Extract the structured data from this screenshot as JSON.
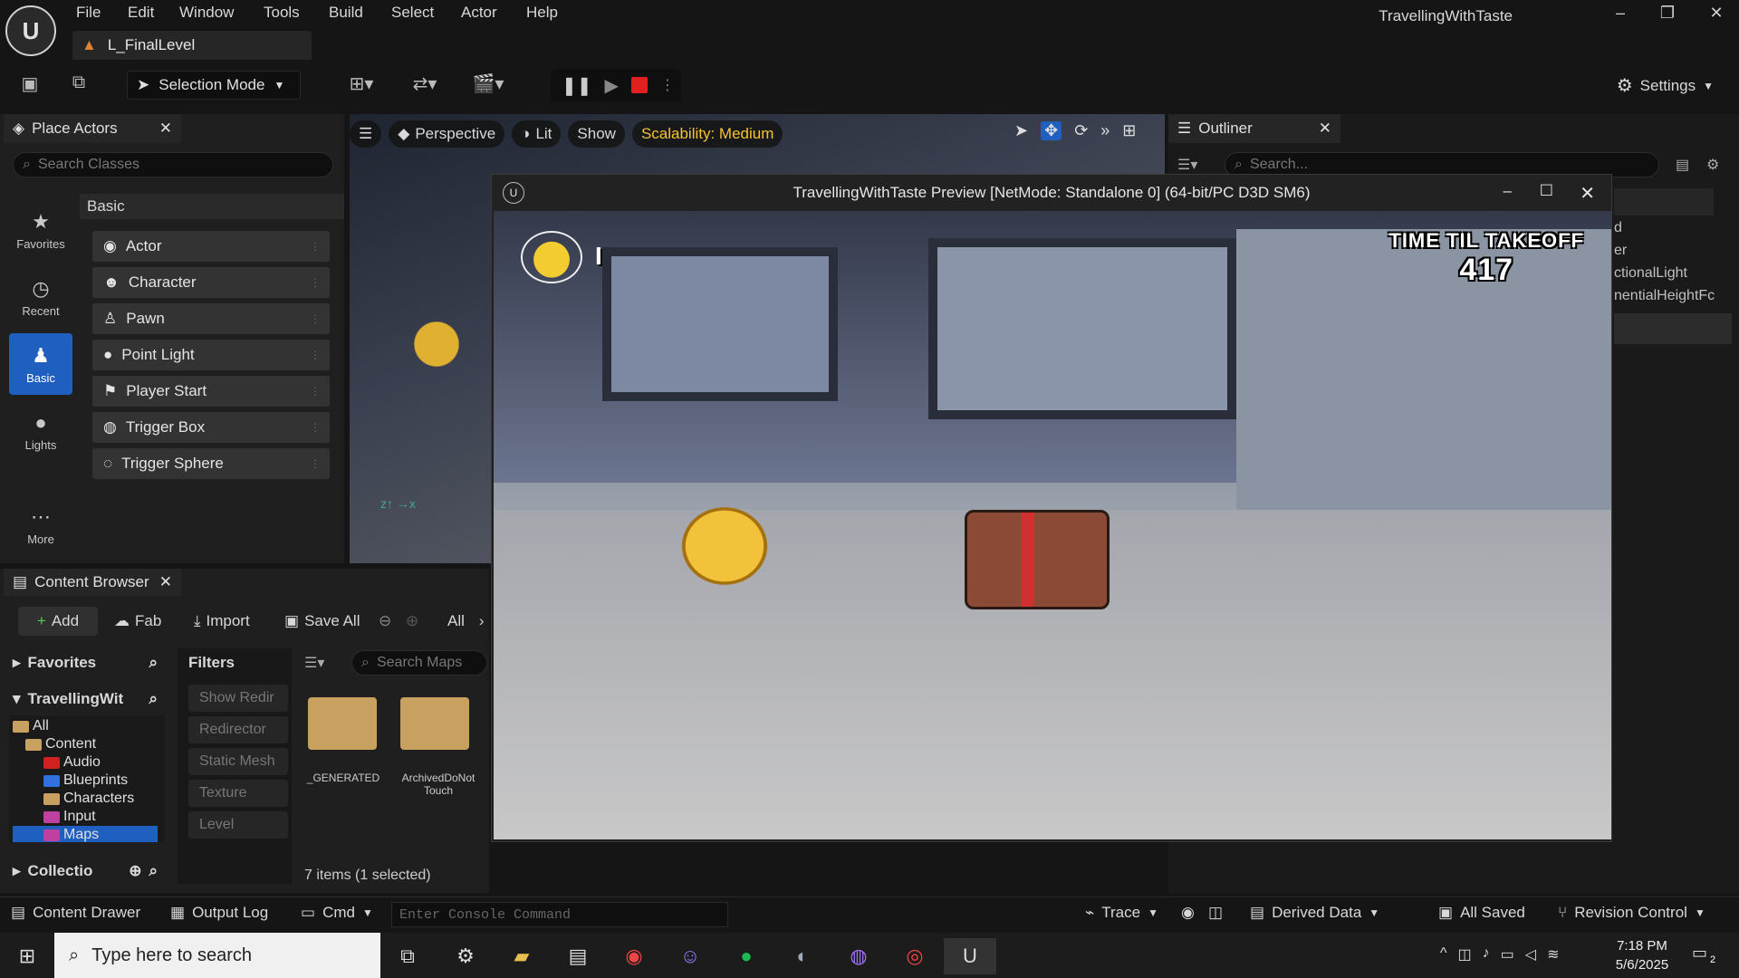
{
  "menu": [
    "File",
    "Edit",
    "Window",
    "Tools",
    "Build",
    "Select",
    "Actor",
    "Help"
  ],
  "project_name": "TravellingWithTaste",
  "level_tab": "L_FinalLevel",
  "toolbar": {
    "selection_mode": "Selection Mode",
    "settings": "Settings"
  },
  "place_actors": {
    "title": "Place Actors",
    "search_placeholder": "Search Classes",
    "categories": [
      {
        "label": "Favorites",
        "icon": "star-icon"
      },
      {
        "label": "Recent",
        "icon": "clock-icon"
      },
      {
        "label": "Basic",
        "icon": "basic-actors-icon"
      },
      {
        "label": "Lights",
        "icon": "bulb-icon"
      },
      {
        "label": "More",
        "icon": "ellipsis-icon"
      }
    ],
    "section": "Basic",
    "items": [
      "Actor",
      "Character",
      "Pawn",
      "Point Light",
      "Player Start",
      "Trigger Box",
      "Trigger Sphere"
    ]
  },
  "viewport": {
    "perspective": "Perspective",
    "lit": "Lit",
    "show": "Show",
    "scalability": "Scalability: Medium"
  },
  "outliner": {
    "title": "Outliner",
    "search_placeholder": "Search...",
    "rows": [
      "d",
      "er",
      "ctionalLight",
      "nentialHeightFc"
    ]
  },
  "preview": {
    "title": "TravellingWithTaste Preview [NetMode: Standalone 0]  (64-bit/PC D3D SM6)",
    "hud_label": "TIME TIL TAKEOFF",
    "hud_value": "417",
    "cheese_count": "I"
  },
  "content_browser": {
    "title": "Content Browser",
    "add": "Add",
    "fab": "Fab",
    "import": "Import",
    "save_all": "Save All",
    "path": "All",
    "favorites": "Favorites",
    "project": "TravellingWit",
    "collections": "Collectio",
    "filters_title": "Filters",
    "search_placeholder": "Search Maps",
    "tree": [
      "All",
      "Content",
      "Audio",
      "Blueprints",
      "Characters",
      "Input",
      "Maps"
    ],
    "filters": [
      "Show Redir",
      "Redirector",
      "Static Mesh",
      "Texture",
      "Level"
    ],
    "assets": [
      "_GENERATED",
      "ArchivedDoNot Touch"
    ],
    "status": "7 items (1 selected)"
  },
  "bottom_bar": {
    "content_drawer": "Content Drawer",
    "output_log": "Output Log",
    "cmd": "Cmd",
    "console_placeholder": "Enter Console Command",
    "trace": "Trace",
    "derived_data": "Derived Data",
    "all_saved": "All Saved",
    "revision_control": "Revision Control"
  },
  "taskbar": {
    "search_placeholder": "Type here to search",
    "time": "7:18 PM",
    "date": "5/6/2025",
    "notifications": "2"
  },
  "colors": {
    "accent": "#1f5fbf",
    "stop": "#e02020",
    "scalability": "#f4c430"
  }
}
